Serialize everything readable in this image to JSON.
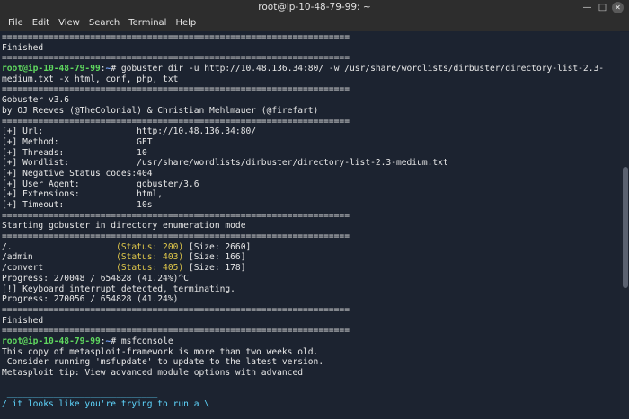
{
  "window": {
    "title": "root@ip-10-48-79-99: ~"
  },
  "menu": [
    "File",
    "Edit",
    "View",
    "Search",
    "Terminal",
    "Help"
  ],
  "prompt": {
    "user_host": "root@ip-10-48-79-99",
    "path": "~"
  },
  "terminal": {
    "l0": "===================================================================",
    "l1": "Finished",
    "l2": "===================================================================",
    "cmd1_a": "gobuster dir -u http://10.48.136.34:80/ -w /usr/share/wordlists/dirbuster/directory-list-2.3-",
    "cmd1_b": "medium.txt -x html, conf, php, txt",
    "l5": "===================================================================",
    "l6": "Gobuster v3.6",
    "l7": "by OJ Reeves (@TheColonial) & Christian Mehlmauer (@firefart)",
    "l8": "===================================================================",
    "cfg": [
      {
        "key": "[+] Url:",
        "value": "http://10.48.136.34:80/"
      },
      {
        "key": "[+] Method:",
        "value": "GET"
      },
      {
        "key": "[+] Threads:",
        "value": "10"
      },
      {
        "key": "[+] Wordlist:",
        "value": "/usr/share/wordlists/dirbuster/directory-list-2.3-medium.txt"
      },
      {
        "key": "[+] Negative Status codes:",
        "value": "404"
      },
      {
        "key": "[+] User Agent:",
        "value": "gobuster/3.6"
      },
      {
        "key": "[+] Extensions:",
        "value": "html,"
      },
      {
        "key": "[+] Timeout:",
        "value": "10s"
      }
    ],
    "l17": "===================================================================",
    "l18": "Starting gobuster in directory enumeration mode",
    "l19": "===================================================================",
    "results": [
      {
        "path": "/.",
        "status": "(Status: 200)",
        "size": "[Size: 2660]"
      },
      {
        "path": "/admin",
        "status": "(Status: 403)",
        "size": "[Size: 166]"
      },
      {
        "path": "/convert",
        "status": "(Status: 405)",
        "size": "[Size: 178]"
      }
    ],
    "l23": "Progress: 270048 / 654828 (41.24%)^C",
    "l24": "[!] Keyboard interrupt detected, terminating.",
    "l25": "Progress: 270056 / 654828 (41.24%)",
    "l26": "===================================================================",
    "l27": "Finished",
    "l28": "===================================================================",
    "cmd2": "msfconsole",
    "l30": "This copy of metasploit-framework is more than two weeks old.",
    "l31": " Consider running 'msfupdate' to update to the latest version.",
    "l32": "Metasploit tip: View advanced module options with advanced",
    "l33": "",
    "l34": " _____________________________",
    "l35": "/ it looks like you're trying to run a \\"
  },
  "colors": {
    "prompt_user": "#5fd75f",
    "prompt_path": "#7aa7ff",
    "status": "#e0c84a",
    "background": "#1c2330"
  }
}
